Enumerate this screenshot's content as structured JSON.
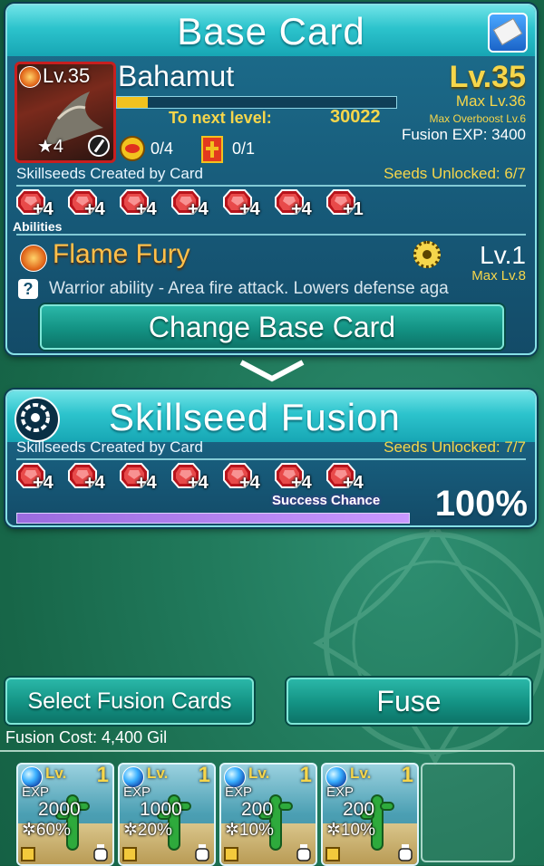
{
  "base_card": {
    "title": "Base Card",
    "card_level_badge": "Lv.35",
    "card_stars": "★4",
    "name": "Bahamut",
    "level": "Lv.35",
    "max_level": "Max Lv.36",
    "max_overboost": "Max Overboost Lv.6",
    "exp_progress": 0.11,
    "to_next_label": "To next level:",
    "to_next_value": "30022",
    "fusion_exp": "Fusion EXP: 3400",
    "counter_a": "0/4",
    "counter_b": "0/1",
    "skillseeds_label": "Skillseeds Created by Card",
    "seeds_unlocked": "Seeds Unlocked: 6/7",
    "seeds": [
      "+4",
      "+4",
      "+4",
      "+4",
      "+4",
      "+4",
      "+1"
    ],
    "abilities_label": "Abilities",
    "ability_name": "Flame Fury",
    "ability_level": "Lv.1",
    "ability_max": "Max Lv.8",
    "ability_desc": "Warrior ability - Area fire attack. Lowers defense aga",
    "change_button": "Change Base Card"
  },
  "fusion": {
    "title": "Skillseed Fusion",
    "skillseeds_label": "Skillseeds Created by Card",
    "seeds_unlocked": "Seeds Unlocked: 7/7",
    "seeds": [
      "+4",
      "+4",
      "+4",
      "+4",
      "+4",
      "+4",
      "+4"
    ],
    "success_label": "Success Chance",
    "success_value": "100%",
    "success_fraction": 1.0
  },
  "actions": {
    "select_button": "Select Fusion Cards",
    "fuse_button": "Fuse",
    "fusion_cost": "Fusion Cost: 4,400 Gil"
  },
  "slots": [
    {
      "lv_label": "Lv.",
      "lv": "1",
      "exp_label": "EXP",
      "exp": "2000",
      "pct": "60%"
    },
    {
      "lv_label": "Lv.",
      "lv": "1",
      "exp_label": "EXP",
      "exp": "1000",
      "pct": "20%"
    },
    {
      "lv_label": "Lv.",
      "lv": "1",
      "exp_label": "EXP",
      "exp": "200",
      "pct": "10%"
    },
    {
      "lv_label": "Lv.",
      "lv": "1",
      "exp_label": "EXP",
      "exp": "200",
      "pct": "10%"
    }
  ],
  "colors": {
    "accent": "#2cc3cc",
    "gold": "#f6d64b",
    "panel": "#175b7a",
    "bar_success": "#b07be0",
    "bar_exp": "#f2c21e"
  }
}
